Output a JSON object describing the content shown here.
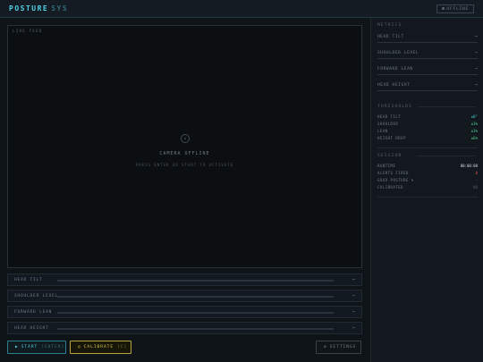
{
  "app": {
    "title_a": "POSTURE",
    "title_b": "SYS",
    "status": "OFFLINE"
  },
  "feed": {
    "label": "LIVE FEED",
    "offline_title": "CAMERA OFFLINE",
    "offline_hint": "PRESS ENTER OR START TO ACTIVATE"
  },
  "bars": [
    {
      "label": "HEAD TILT",
      "value": "—",
      "level": 0
    },
    {
      "label": "SHOULDER LEVEL",
      "value": "—",
      "level": 0
    },
    {
      "label": "FORWARD LEAN",
      "value": "—",
      "level": 0
    },
    {
      "label": "HEAD HEIGHT",
      "value": "—",
      "level": 0
    }
  ],
  "buttons": {
    "start": {
      "label": "START",
      "hint": "[ENTER]"
    },
    "calibrate": {
      "label": "CALIBRATE",
      "hint": "[C]"
    },
    "settings": {
      "label": "SETTINGS"
    }
  },
  "metrics": {
    "title": "METRICS",
    "items": [
      {
        "label": "HEAD TILT",
        "value": "—"
      },
      {
        "label": "SHOULDER LEVEL",
        "value": "—"
      },
      {
        "label": "FORWARD LEAN",
        "value": "—"
      },
      {
        "label": "HEAD HEIGHT",
        "value": "—"
      }
    ]
  },
  "thresholds": {
    "title": "THRESHOLDS",
    "items": [
      {
        "label": "HEAD TILT",
        "value": "±8°"
      },
      {
        "label": "SHOULDER",
        "value": "±3%"
      },
      {
        "label": "LEAN",
        "value": "±3%"
      },
      {
        "label": "HEIGHT DROP",
        "value": "±6%"
      }
    ]
  },
  "session": {
    "title": "SESSION",
    "items": [
      {
        "label": "RUNTIME",
        "value": "00:00:00"
      },
      {
        "label": "ALERTS FIRED",
        "value": "0"
      },
      {
        "label": "GOOD POSTURE %",
        "value": "—"
      },
      {
        "label": "CALIBRATED",
        "value": "NO"
      }
    ]
  },
  "colors": {
    "accent": "#4fd1e8",
    "warn": "#e1c84a",
    "ok": "#46d68a",
    "alert": "#e05050"
  }
}
